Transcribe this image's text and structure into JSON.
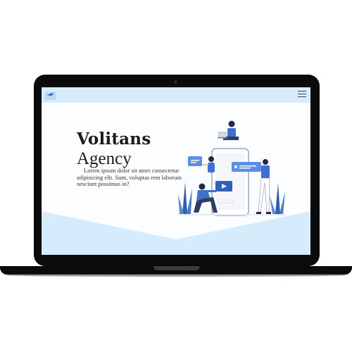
{
  "hero": {
    "title": "Volitans",
    "subtitle": "Agency",
    "description": "Lorem ipsum dolor sit amet consectetur adipisicing elit. Sunt, voluptas rem laborum nesciunt possimus in?"
  },
  "header": {
    "logo_icon": "bird-logo-icon",
    "menu_icon": "hamburger-menu-icon"
  },
  "colors": {
    "header_bg": "#d8ebfb",
    "accent_blue": "#5b8fe6",
    "wave": "#d6ebfb",
    "laptop": "#0b0b0b"
  }
}
